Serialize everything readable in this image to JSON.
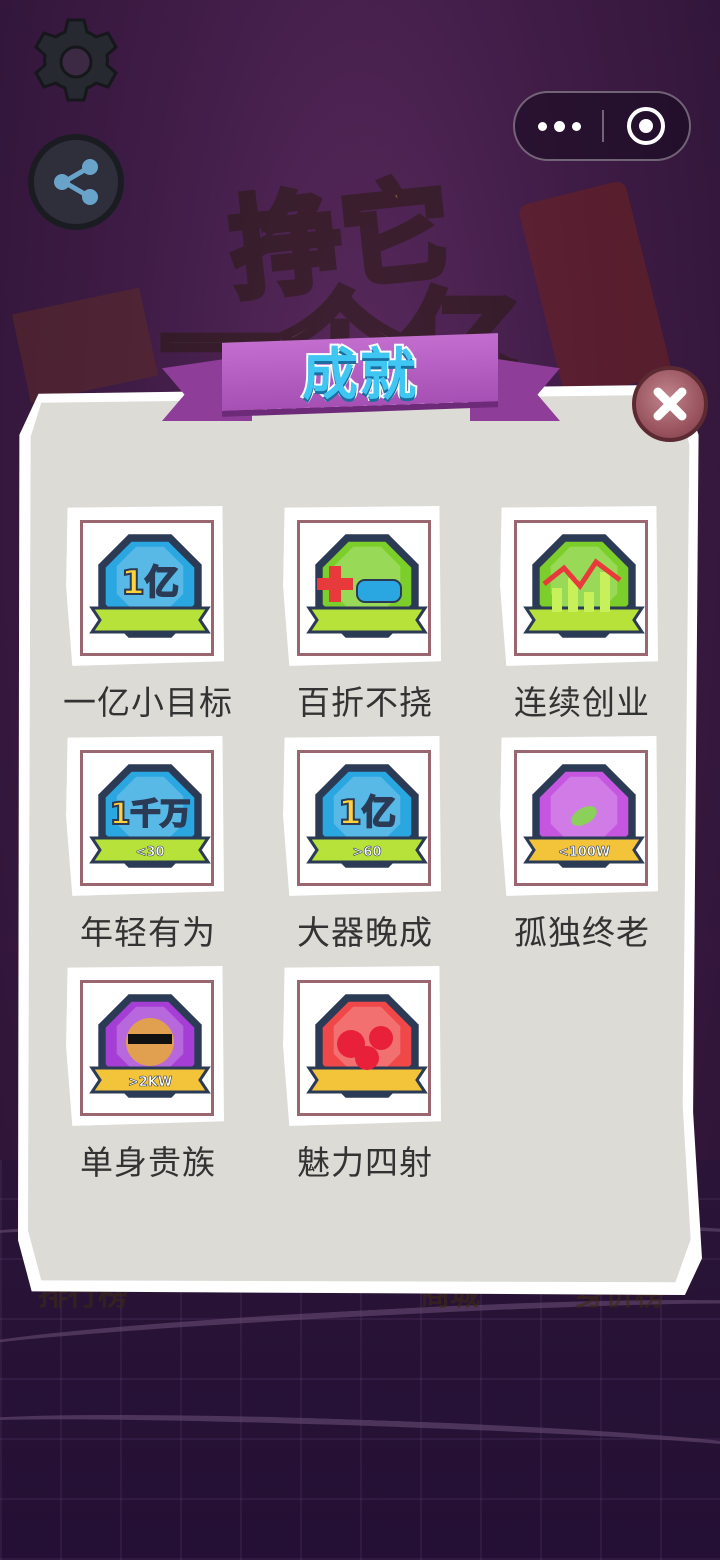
{
  "title": "成就",
  "background": {
    "game_title_line1": "挣它",
    "game_title_line2": "一个亿",
    "bottom_labels": [
      "排行榜",
      "商城",
      "身价榜"
    ]
  },
  "achievements": [
    {
      "label": "一亿小目标",
      "badge_text": "1亿",
      "badge_sub": "",
      "badge_color": "#2aa6e0",
      "icon": "one-hundred-million-badge-icon"
    },
    {
      "label": "百折不挠",
      "badge_text": "",
      "badge_sub": "",
      "badge_color": "#7ccf2a",
      "icon": "ambulance-badge-icon"
    },
    {
      "label": "连续创业",
      "badge_text": "",
      "badge_sub": "",
      "badge_color": "#7ccf2a",
      "icon": "stock-chart-badge-icon"
    },
    {
      "label": "年轻有为",
      "badge_text": "1千万",
      "badge_sub": "<30",
      "badge_color": "#2aa6e0",
      "icon": "ten-million-badge-icon"
    },
    {
      "label": "大器晚成",
      "badge_text": "1亿",
      "badge_sub": ">60",
      "badge_color": "#2aa6e0",
      "icon": "one-hundred-million-badge-icon"
    },
    {
      "label": "孤独终老",
      "badge_text": "",
      "badge_sub": "<100W",
      "badge_color": "#c556e0",
      "icon": "bubble-leaf-badge-icon"
    },
    {
      "label": "单身贵族",
      "badge_text": "",
      "badge_sub": ">2KW",
      "badge_color": "#a53ed4",
      "icon": "cool-dog-badge-icon"
    },
    {
      "label": "魅力四射",
      "badge_text": "",
      "badge_sub": "",
      "badge_color": "#f04848",
      "icon": "hearts-badge-icon"
    }
  ],
  "icons": {
    "settings": "gear-icon",
    "share": "share-icon",
    "close": "close-icon",
    "more": "more-dots-icon",
    "exit": "target-icon"
  }
}
